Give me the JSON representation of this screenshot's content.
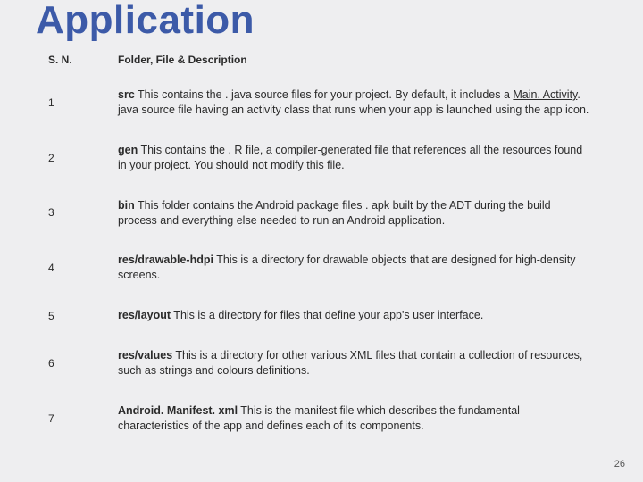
{
  "title": "Application",
  "page_number": "26",
  "columns": {
    "sn": "S. N.",
    "desc": "Folder, File & Description"
  },
  "rows": [
    {
      "sn": "1",
      "folder": "src",
      "desc_prefix": " This contains the . java source files for your project. By default, it includes a ",
      "desc_underlined": "Main. Activity",
      "desc_suffix": ". java source file having an activity class that runs when your app is launched using the app icon."
    },
    {
      "sn": "2",
      "folder": "gen",
      "desc_prefix": " This contains the . R file, a compiler-generated file that references all the resources found in your project. You should not modify this file.",
      "desc_underlined": "",
      "desc_suffix": ""
    },
    {
      "sn": "3",
      "folder": "bin",
      "desc_prefix": " This folder contains the Android package files . apk built by the ADT during the build process and everything else needed to run an Android application.",
      "desc_underlined": "",
      "desc_suffix": ""
    },
    {
      "sn": "4",
      "folder": "res/drawable-hdpi",
      "desc_prefix": " This is a directory for drawable objects that are designed for high-density screens.",
      "desc_underlined": "",
      "desc_suffix": ""
    },
    {
      "sn": "5",
      "folder": "res/layout",
      "desc_prefix": " This is a directory for files that define your app's user interface.",
      "desc_underlined": "",
      "desc_suffix": ""
    },
    {
      "sn": "6",
      "folder": "res/values",
      "desc_prefix": " This is a directory for other various XML files that contain a collection of resources, such as strings and colours definitions.",
      "desc_underlined": "",
      "desc_suffix": ""
    },
    {
      "sn": "7",
      "folder": "Android. Manifest. xml",
      "desc_prefix": " This is the manifest file which describes the fundamental characteristics of the app and defines each of its components.",
      "desc_underlined": "",
      "desc_suffix": ""
    }
  ]
}
